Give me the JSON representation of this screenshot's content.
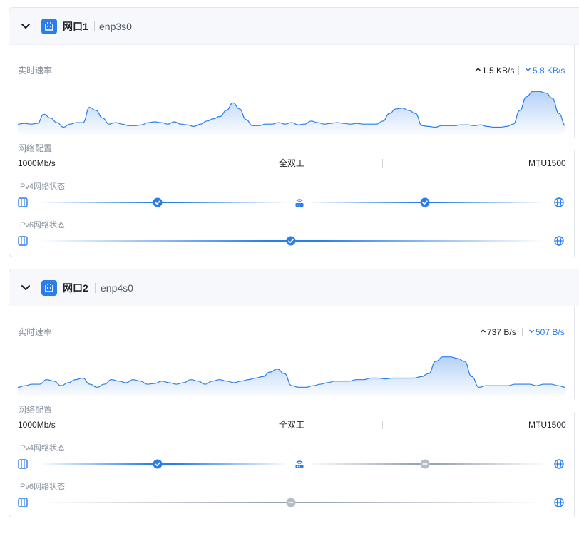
{
  "interfaces": [
    {
      "name": "网口1",
      "device": "enp3s0",
      "speed_label": "实时速率",
      "upload": "1.5 KB/s",
      "download": "5.8 KB/s",
      "config_label": "网络配置",
      "link_speed": "1000Mb/s",
      "duplex": "全双工",
      "mtu": "MTU1500",
      "ipv4_label": "IPv4网络状态",
      "ipv6_label": "IPv6网络状态",
      "ipv4_status": [
        "ok",
        "ok"
      ],
      "ipv6_status": [
        "ok"
      ],
      "traffic_series": [
        12,
        13,
        12,
        13,
        25,
        20,
        14,
        8,
        12,
        14,
        14,
        34,
        30,
        20,
        12,
        14,
        12,
        10,
        10,
        11,
        14,
        15,
        14,
        12,
        15,
        12,
        11,
        9,
        12,
        16,
        19,
        22,
        30,
        40,
        32,
        18,
        10,
        10,
        12,
        12,
        14,
        12,
        14,
        11,
        12,
        16,
        14,
        12,
        13,
        14,
        13,
        12,
        13,
        12,
        12,
        12,
        16,
        26,
        32,
        33,
        30,
        26,
        10,
        9,
        8,
        10,
        10,
        10,
        11,
        11,
        10,
        11,
        9,
        8,
        8,
        9,
        12,
        30,
        48,
        55,
        55,
        53,
        46,
        26,
        10
      ]
    },
    {
      "name": "网口2",
      "device": "enp4s0",
      "speed_label": "实时速率",
      "upload": "737 B/s",
      "download": "507 B/s",
      "config_label": "网络配置",
      "link_speed": "1000Mb/s",
      "duplex": "全双工",
      "mtu": "MTU1500",
      "ipv4_label": "IPv4网络状态",
      "ipv6_label": "IPv6网络状态",
      "ipv4_status": [
        "ok",
        "off"
      ],
      "ipv6_status": [
        "off"
      ],
      "traffic_series": [
        10,
        12,
        14,
        14,
        20,
        18,
        12,
        16,
        20,
        22,
        14,
        10,
        14,
        20,
        18,
        16,
        20,
        18,
        14,
        15,
        18,
        16,
        14,
        16,
        20,
        18,
        14,
        18,
        20,
        18,
        16,
        18,
        20,
        22,
        24,
        30,
        34,
        28,
        12,
        10,
        10,
        12,
        14,
        16,
        18,
        18,
        18,
        20,
        20,
        22,
        22,
        21,
        22,
        22,
        22,
        22,
        24,
        28,
        44,
        50,
        50,
        48,
        44,
        24,
        10,
        12,
        12,
        12,
        12,
        14,
        14,
        14,
        12,
        14,
        14,
        12,
        10
      ]
    }
  ],
  "colors": {
    "accent": "#2b7de9",
    "ok_node": "#2b7de9",
    "off_node": "#b4bcc8",
    "ok_line": "#2b7de9",
    "off_line": "#9aa3b1"
  },
  "icons": {
    "collapse": "chevron-down-icon",
    "interface": "ethernet-port-icon",
    "host": "server-icon",
    "router": "router-icon",
    "internet": "globe-icon",
    "ok": "check-circle-icon",
    "off": "minus-circle-icon",
    "upload": "arrow-up-icon",
    "download": "arrow-down-icon"
  }
}
